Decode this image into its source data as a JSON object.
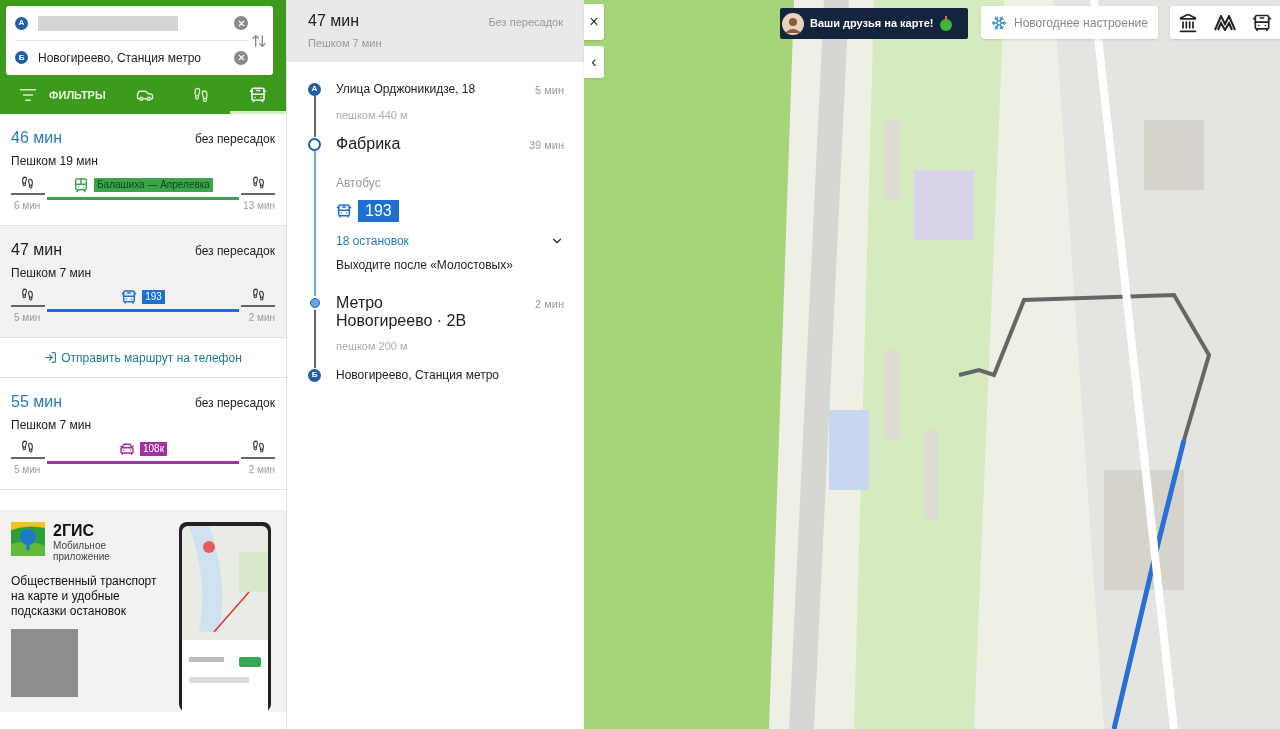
{
  "search": {
    "from": {
      "marker": "А",
      "redacted": true
    },
    "to": {
      "marker": "Б",
      "value": "Новогиреево, Станция метро"
    }
  },
  "modes": [
    {
      "kind": "filters",
      "label": "ФИЛЬТРЫ",
      "selected": false
    },
    {
      "kind": "car",
      "selected": false
    },
    {
      "kind": "walk",
      "selected": false
    },
    {
      "kind": "bus",
      "selected": true
    }
  ],
  "routes": [
    {
      "time": "46 мин",
      "transfers": "без пересадок",
      "walk": "Пешком 19 мин",
      "ride": {
        "kind": "train",
        "label": "Балашиха — Апрелевка",
        "color": "#3aa54a"
      },
      "walk_start": "6 мин",
      "walk_end": "13 мин",
      "selected": false
    },
    {
      "time": "47 мин",
      "transfers": "без пересадок",
      "walk": "Пешком 7 мин",
      "ride": {
        "kind": "bus",
        "label": "193",
        "color": "#1e6fd0"
      },
      "walk_start": "5 мин",
      "walk_end": "2 мин",
      "selected": true
    },
    {
      "kind": "send_link",
      "label": "Отправить маршрут на телефон"
    },
    {
      "time": "55 мин",
      "transfers": "без пересадок",
      "walk": "Пешком 7 мин",
      "ride": {
        "kind": "minibus",
        "label": "108к",
        "color": "#a3309f"
      },
      "walk_start": "5 мин",
      "walk_end": "2 мин",
      "selected": false
    }
  ],
  "promo": {
    "brand": "2ГИС",
    "subtitle": "Мобильное приложение",
    "text": "Общественный транспорт на карте и удобные подсказки остановок"
  },
  "detail": {
    "time": "47 мин",
    "walk": "Пешком 7 мин",
    "transfers": "Без пересадок",
    "steps": [
      {
        "kind": "start",
        "marker": "А",
        "title": "Улица Орджоникидзе, 18",
        "time": "5 мин",
        "note": "пешком 440 м"
      },
      {
        "kind": "board",
        "title": "Фабрика",
        "time": "39 мин",
        "transport": "Автобус",
        "ride": {
          "kind": "bus",
          "number": "193",
          "color": "#1e6fd0"
        },
        "stops": "18 остановок",
        "expanded": false,
        "exit": "Выходите после «Молостовых»"
      },
      {
        "kind": "alight",
        "title": "Метро Новогиреево · 2В",
        "time": "2 мин",
        "note": "пешком 200 м"
      },
      {
        "kind": "finish",
        "marker": "Б",
        "title": "Новогиреево, Станция метро"
      }
    ]
  },
  "map": {
    "close": "×",
    "collapse": "‹",
    "friends_banner": "Ваши друзья на карте!",
    "mood_button": "Новогоднее настроение"
  }
}
